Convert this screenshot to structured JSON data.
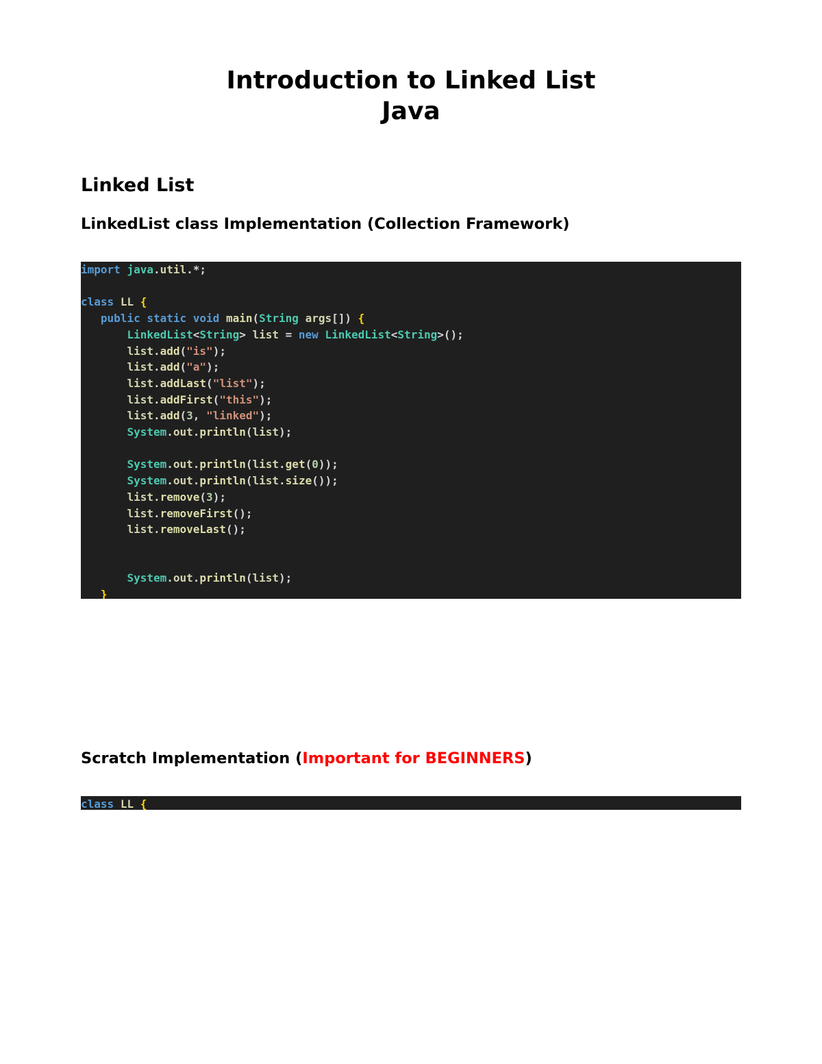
{
  "title_line1": "Introduction to Linked List",
  "title_line2": "Java",
  "section_heading": "Linked List",
  "sub_heading_1": "LinkedList class Implementation (Collection Framework)",
  "sub_heading_2_a": "Scratch Implementation (",
  "sub_heading_2_b": "Important for BEGINNERS",
  "sub_heading_2_c": ")",
  "code1": [
    [
      [
        "ky",
        "import"
      ],
      [
        "pn",
        " "
      ],
      [
        "pkg",
        "java"
      ],
      [
        "pn",
        "."
      ],
      [
        "id",
        "util"
      ],
      [
        "pn",
        ".*;"
      ]
    ],
    [],
    [
      [
        "ky",
        "class"
      ],
      [
        "pn",
        " "
      ],
      [
        "id",
        "LL"
      ],
      [
        "pn",
        " "
      ],
      [
        "br",
        "{"
      ]
    ],
    [
      [
        "pn",
        "   "
      ],
      [
        "ky",
        "public"
      ],
      [
        "pn",
        " "
      ],
      [
        "ky",
        "static"
      ],
      [
        "pn",
        " "
      ],
      [
        "ky",
        "void"
      ],
      [
        "pn",
        " "
      ],
      [
        "fn",
        "main"
      ],
      [
        "pn",
        "("
      ],
      [
        "pkg",
        "String"
      ],
      [
        "pn",
        " "
      ],
      [
        "id",
        "args"
      ],
      [
        "pn",
        "[]) "
      ],
      [
        "br",
        "{"
      ]
    ],
    [
      [
        "pn",
        "       "
      ],
      [
        "pkg",
        "LinkedList"
      ],
      [
        "pn",
        "<"
      ],
      [
        "pkg",
        "String"
      ],
      [
        "pn",
        "> "
      ],
      [
        "id",
        "list"
      ],
      [
        "pn",
        " = "
      ],
      [
        "ky",
        "new"
      ],
      [
        "pn",
        " "
      ],
      [
        "pkg",
        "LinkedList"
      ],
      [
        "pn",
        "<"
      ],
      [
        "pkg",
        "String"
      ],
      [
        "pn",
        ">();"
      ]
    ],
    [
      [
        "pn",
        "       "
      ],
      [
        "id",
        "list"
      ],
      [
        "pn",
        "."
      ],
      [
        "fn",
        "add"
      ],
      [
        "pn",
        "("
      ],
      [
        "str",
        "\"is\""
      ],
      [
        "pn",
        ");"
      ]
    ],
    [
      [
        "pn",
        "       "
      ],
      [
        "id",
        "list"
      ],
      [
        "pn",
        "."
      ],
      [
        "fn",
        "add"
      ],
      [
        "pn",
        "("
      ],
      [
        "str",
        "\"a\""
      ],
      [
        "pn",
        ");"
      ]
    ],
    [
      [
        "pn",
        "       "
      ],
      [
        "id",
        "list"
      ],
      [
        "pn",
        "."
      ],
      [
        "fn",
        "addLast"
      ],
      [
        "pn",
        "("
      ],
      [
        "str",
        "\"list\""
      ],
      [
        "pn",
        ");"
      ]
    ],
    [
      [
        "pn",
        "       "
      ],
      [
        "id",
        "list"
      ],
      [
        "pn",
        "."
      ],
      [
        "fn",
        "addFirst"
      ],
      [
        "pn",
        "("
      ],
      [
        "str",
        "\"this\""
      ],
      [
        "pn",
        ");"
      ]
    ],
    [
      [
        "pn",
        "       "
      ],
      [
        "id",
        "list"
      ],
      [
        "pn",
        "."
      ],
      [
        "fn",
        "add"
      ],
      [
        "pn",
        "("
      ],
      [
        "num",
        "3"
      ],
      [
        "pn",
        ", "
      ],
      [
        "str",
        "\"linked\""
      ],
      [
        "pn",
        ");"
      ]
    ],
    [
      [
        "pn",
        "       "
      ],
      [
        "pkg",
        "System"
      ],
      [
        "pn",
        "."
      ],
      [
        "id",
        "out"
      ],
      [
        "pn",
        "."
      ],
      [
        "fn",
        "println"
      ],
      [
        "pn",
        "("
      ],
      [
        "id",
        "list"
      ],
      [
        "pn",
        ");"
      ]
    ],
    [],
    [
      [
        "pn",
        "       "
      ],
      [
        "pkg",
        "System"
      ],
      [
        "pn",
        "."
      ],
      [
        "id",
        "out"
      ],
      [
        "pn",
        "."
      ],
      [
        "fn",
        "println"
      ],
      [
        "pn",
        "("
      ],
      [
        "id",
        "list"
      ],
      [
        "pn",
        "."
      ],
      [
        "fn",
        "get"
      ],
      [
        "pn",
        "("
      ],
      [
        "num",
        "0"
      ],
      [
        "pn",
        "));"
      ]
    ],
    [
      [
        "pn",
        "       "
      ],
      [
        "pkg",
        "System"
      ],
      [
        "pn",
        "."
      ],
      [
        "id",
        "out"
      ],
      [
        "pn",
        "."
      ],
      [
        "fn",
        "println"
      ],
      [
        "pn",
        "("
      ],
      [
        "id",
        "list"
      ],
      [
        "pn",
        "."
      ],
      [
        "fn",
        "size"
      ],
      [
        "pn",
        "());"
      ]
    ],
    [
      [
        "pn",
        "       "
      ],
      [
        "id",
        "list"
      ],
      [
        "pn",
        "."
      ],
      [
        "fn",
        "remove"
      ],
      [
        "pn",
        "("
      ],
      [
        "num",
        "3"
      ],
      [
        "pn",
        ");"
      ]
    ],
    [
      [
        "pn",
        "       "
      ],
      [
        "id",
        "list"
      ],
      [
        "pn",
        "."
      ],
      [
        "fn",
        "removeFirst"
      ],
      [
        "pn",
        "();"
      ]
    ],
    [
      [
        "pn",
        "       "
      ],
      [
        "id",
        "list"
      ],
      [
        "pn",
        "."
      ],
      [
        "fn",
        "removeLast"
      ],
      [
        "pn",
        "();"
      ]
    ],
    [],
    [],
    [
      [
        "pn",
        "       "
      ],
      [
        "pkg",
        "System"
      ],
      [
        "pn",
        "."
      ],
      [
        "id",
        "out"
      ],
      [
        "pn",
        "."
      ],
      [
        "fn",
        "println"
      ],
      [
        "pn",
        "("
      ],
      [
        "id",
        "list"
      ],
      [
        "pn",
        ");"
      ]
    ],
    [
      [
        "pn",
        "   "
      ],
      [
        "br",
        "}"
      ]
    ],
    [
      [
        "br",
        "}"
      ]
    ]
  ],
  "code2": [
    [
      [
        "ky",
        "class"
      ],
      [
        "pn",
        " "
      ],
      [
        "id",
        "LL"
      ],
      [
        "pn",
        " "
      ],
      [
        "br",
        "{"
      ]
    ]
  ]
}
